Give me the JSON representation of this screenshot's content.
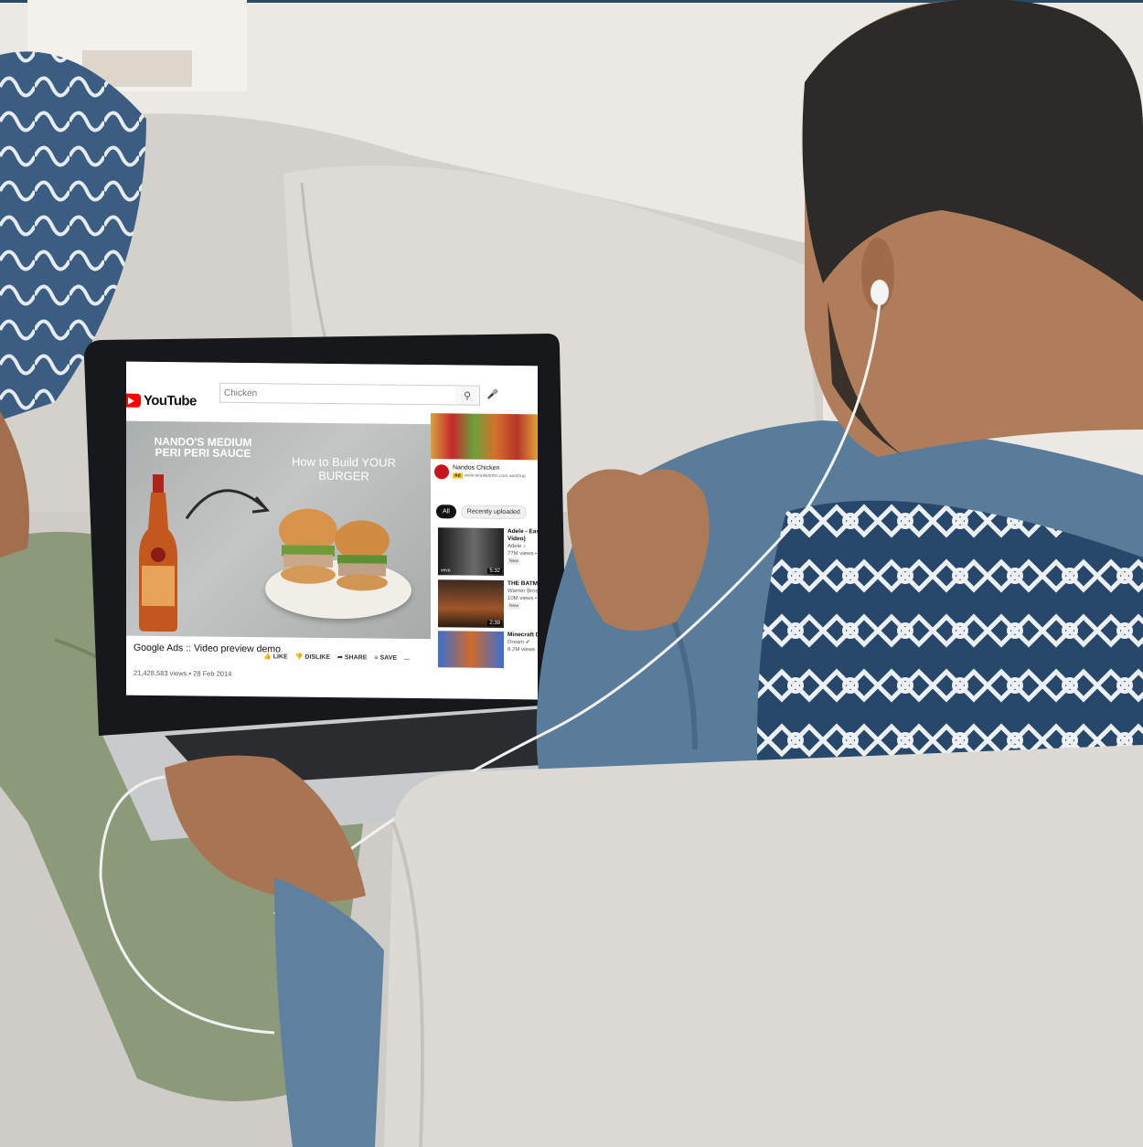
{
  "youtube": {
    "logo_text": "YouTube",
    "search_placeholder": "Chicken",
    "search_icon": "search-icon",
    "mic_icon": "mic-icon"
  },
  "player": {
    "overlay_heading": "NANDO'S MEDIUM PERI PERI SAUCE",
    "overlay_subheading": "How to Build YOUR BURGER"
  },
  "video": {
    "title": "Google Ads :: Video preview demo",
    "meta": "21,428,583 views • 28 Feb 2014",
    "actions": {
      "like": "LIKE",
      "dislike": "DISLIKE",
      "share": "SHARE",
      "save": "SAVE",
      "more": "..."
    }
  },
  "sidebar": {
    "ad": {
      "name": "Nandos Chicken",
      "badge": "Ad",
      "url": "www.woolworths.com.au/shop"
    },
    "chips": [
      "All",
      "Recently uploaded"
    ],
    "recommendations": [
      {
        "title": "Adele - Easy",
        "line2": "Video)",
        "channel": "Adele ♪",
        "views": "77M views •",
        "badge": "New",
        "duration": "5:32",
        "thumb_label": "vevo"
      },
      {
        "title": "THE BATMA",
        "line2": "",
        "channel": "Warner Bros.",
        "views": "10M views •",
        "badge": "New",
        "duration": "2:39",
        "thumb_label": ""
      },
      {
        "title": "Minecraft D",
        "line2": "",
        "channel": "Dream ✔",
        "views": "8.2M views",
        "badge": "",
        "duration": "",
        "thumb_label": ""
      }
    ]
  },
  "colors": {
    "youtube_red": "#ff0000",
    "wall": "#e9e6e1",
    "sofa": "#d7d4cf",
    "shirt": "#5a7c9b",
    "pillow_navy": "#27476b",
    "trousers": "#8c9a7a"
  }
}
